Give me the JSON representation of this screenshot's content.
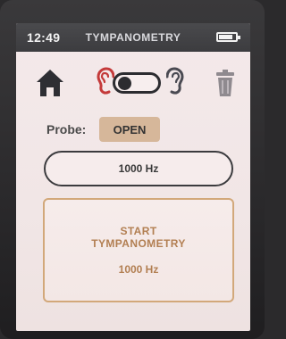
{
  "status_bar": {
    "time": "12:49",
    "title": "TYMPANOMETRY",
    "battery_level": 0.85
  },
  "toolbar": {
    "home_icon": "home-icon",
    "left_ear_icon": "ear-left-icon",
    "right_ear_icon": "ear-right-icon",
    "ear_toggle_selected": "left",
    "trash_icon": "trash-icon",
    "left_ear_color": "#c43a3a",
    "right_ear_color": "#4a4a52"
  },
  "probe": {
    "label": "Probe:",
    "status": "OPEN",
    "status_color": "#d6b79a"
  },
  "frequency_selector": {
    "value": "1000 Hz"
  },
  "start_button": {
    "line1": "START",
    "line2": "TYMPANOMETRY",
    "frequency": "1000 Hz",
    "accent_color": "#b27f52"
  }
}
